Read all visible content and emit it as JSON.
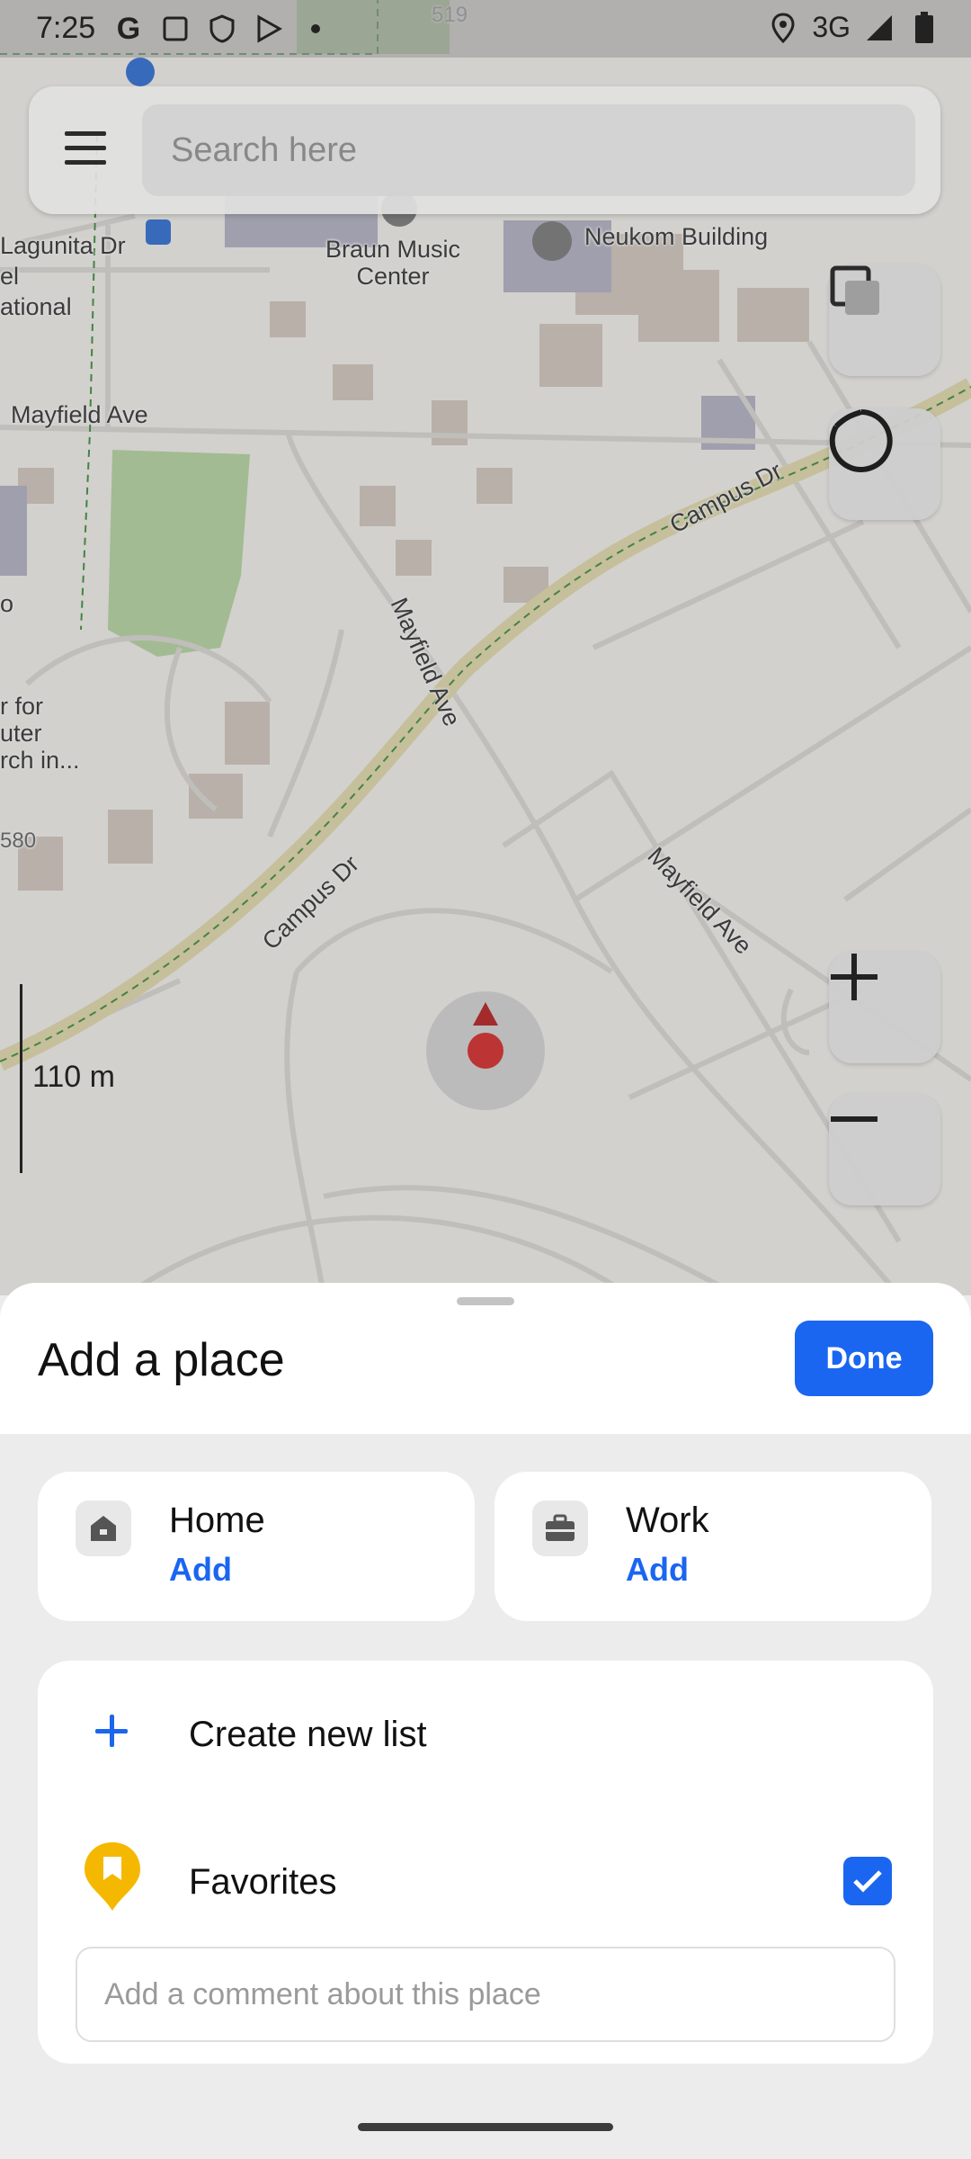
{
  "status_bar": {
    "time": "7:25",
    "network": "3G",
    "icons": [
      "google-icon",
      "screenshot-icon",
      "shield-icon",
      "play-icon",
      "dot-icon",
      "location-icon",
      "signal-icon",
      "battery-icon"
    ]
  },
  "search": {
    "placeholder": "Search here"
  },
  "map": {
    "labels": {
      "lagunita": "Lagunita Dr",
      "braun": "Braun Music\nCenter",
      "neukom": "Neukom Building",
      "mayfield_1": "Mayfield Ave",
      "mayfield_2": "Mayfield Ave",
      "mayfield_3": "Mayfield Ave",
      "campus_1": "Campus Dr",
      "campus_2": "Campus Dr",
      "national": "ational",
      "el": "el",
      "o": "o",
      "research": "r for\nuter\nrch in...",
      "num_519": "519",
      "num_580": "580"
    },
    "scale": "110 m",
    "colors": {
      "road": "#e7dfb4",
      "park": "#b7d6a3",
      "building": "#cfc6bd"
    }
  },
  "sheet": {
    "title": "Add a place",
    "done_label": "Done",
    "home": {
      "title": "Home",
      "action": "Add"
    },
    "work": {
      "title": "Work",
      "action": "Add"
    },
    "create_list_label": "Create new list",
    "favorites_label": "Favorites",
    "favorites_checked": true,
    "comment_placeholder": "Add a comment about this place"
  }
}
